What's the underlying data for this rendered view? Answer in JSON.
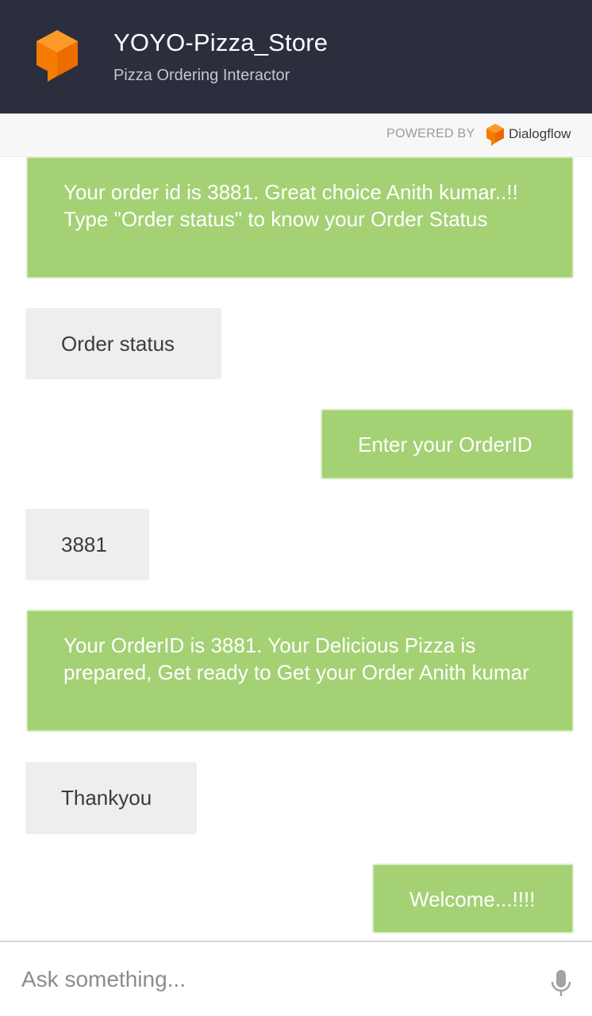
{
  "header": {
    "title": "YOYO-Pizza_Store",
    "subtitle": "Pizza Ordering Interactor",
    "logo_icon": "orange-cube-logo-icon",
    "background": "#2b2f3d"
  },
  "powered_by": {
    "label": "POWERED BY",
    "brand": "Dialogflow",
    "brand_icon": "dialogflow-logo-icon"
  },
  "messages": [
    {
      "sender": "bot",
      "text": "Your order id is 3881. Great choice Anith kumar..!! Type \"Order status\" to know your Order Status"
    },
    {
      "sender": "user",
      "text": "Order status"
    },
    {
      "sender": "bot",
      "text": "Enter your OrderID"
    },
    {
      "sender": "user",
      "text": "3881"
    },
    {
      "sender": "bot",
      "text": "Your OrderID is 3881. Your Delicious Pizza is prepared, Get ready to Get your Order Anith kumar"
    },
    {
      "sender": "user",
      "text": "Thankyou"
    },
    {
      "sender": "bot",
      "text": "Welcome...!!!!"
    }
  ],
  "input": {
    "placeholder": "Ask something...",
    "value": "",
    "mic_icon": "microphone-icon"
  },
  "colors": {
    "bot_bubble": "#a4d174",
    "user_bubble": "#eeeeee",
    "accent": "#f57c00"
  }
}
